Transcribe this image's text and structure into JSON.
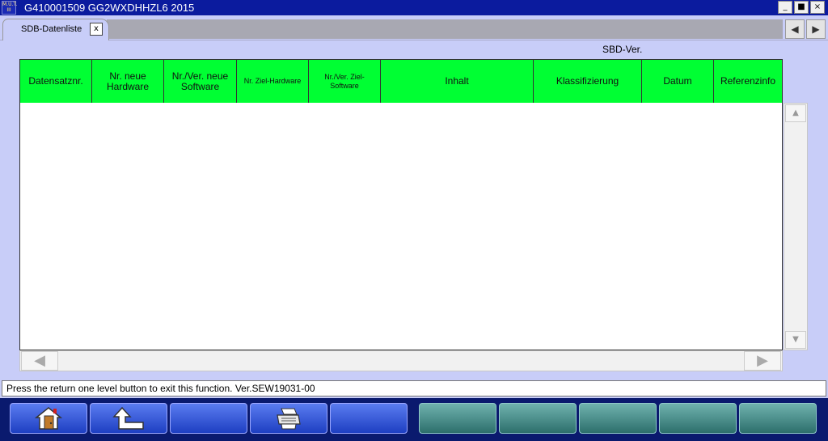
{
  "window": {
    "logo_text": "M.U.T. III",
    "title": "G410001509   GG2WXDHHZL6 2015",
    "buttons": {
      "minimize": "_",
      "maximize": "■",
      "close": "×"
    }
  },
  "tabs": [
    {
      "label": "SDB-Datenliste",
      "close": "x"
    }
  ],
  "tabnav": {
    "prev": "◀",
    "next": "▶"
  },
  "sbd_label": "SBD-Ver.",
  "table": {
    "columns": [
      "Datensatznr.",
      "Nr. neue Hardware",
      "Nr./Ver. neue Software",
      "Nr. Ziel-Hardware",
      "Nr./Ver. Ziel-Software",
      "Inhalt",
      "Klassifizierung",
      "Datum",
      "Referenzinfo"
    ],
    "rows": []
  },
  "scroll": {
    "up": "▲",
    "down": "▼",
    "left": "◀",
    "right": "▶"
  },
  "status_text": "Press the return one level button to exit this function. Ver.SEW19031-00",
  "function_buttons": [
    {
      "name": "home-button",
      "icon": "home-door-icon",
      "style": "blue"
    },
    {
      "name": "return-one-level-button",
      "icon": "return-arrow-icon",
      "style": "blue"
    },
    {
      "name": "function-button-3",
      "icon": "",
      "style": "blue"
    },
    {
      "name": "print-button",
      "icon": "printer-icon",
      "style": "blue"
    },
    {
      "name": "function-button-5",
      "icon": "",
      "style": "blue"
    },
    {
      "name": "function-button-6",
      "icon": "",
      "style": "teal"
    },
    {
      "name": "function-button-7",
      "icon": "",
      "style": "teal"
    },
    {
      "name": "function-button-8",
      "icon": "",
      "style": "teal"
    },
    {
      "name": "function-button-9",
      "icon": "",
      "style": "teal"
    },
    {
      "name": "function-button-10",
      "icon": "",
      "style": "teal"
    }
  ],
  "colors": {
    "titlebar": "#0b1b9e",
    "background": "#c8cdf8",
    "table_header": "#00ff33",
    "funcbar": "#0a1a6e",
    "button_blue": "#2e55d8",
    "button_teal": "#3f8c88"
  }
}
